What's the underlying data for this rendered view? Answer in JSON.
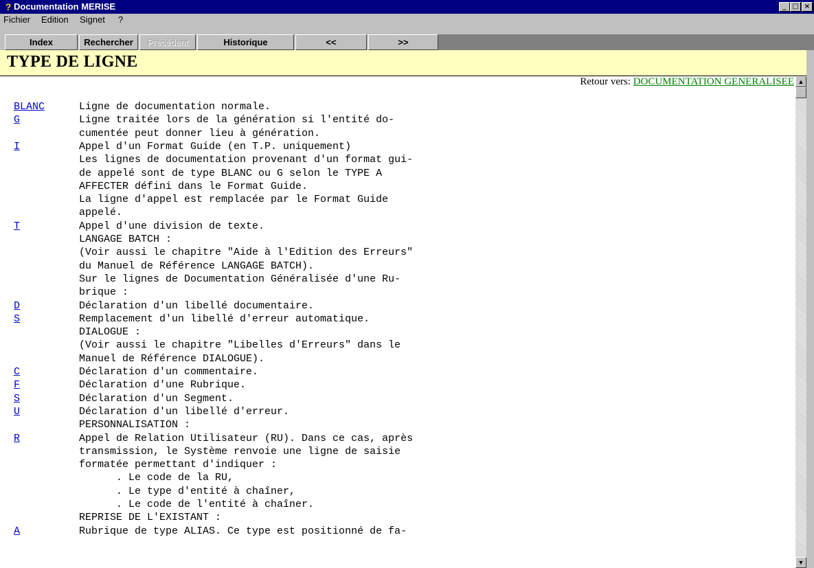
{
  "window": {
    "title": "Documentation MERISE",
    "minimize": "_",
    "maximize": "□",
    "close": "×"
  },
  "menu": [
    {
      "label": "Fichier"
    },
    {
      "label": "Edition"
    },
    {
      "label": "Signet"
    },
    {
      "label": "?"
    }
  ],
  "toolbar": {
    "index": "Index",
    "rechercher": "Rechercher",
    "precedent": "Précédent",
    "historique": "Historique",
    "back": "<<",
    "forward": ">>"
  },
  "page": {
    "title": "TYPE DE LIGNE",
    "retour_label": "Retour vers: ",
    "retour_link": "DOCUMENTATION GENERALISEE"
  },
  "lines": [
    {
      "code": "",
      "text": ""
    },
    {
      "code": "BLANC",
      "text": "Ligne de documentation normale."
    },
    {
      "code": "G",
      "text": "Ligne traitée lors de la génération si l'entité do-"
    },
    {
      "code": "",
      "text": "cumentée peut donner lieu à génération."
    },
    {
      "code": "I",
      "text": "Appel d'un Format Guide (en T.P. uniquement)"
    },
    {
      "code": "",
      "text": "Les lignes de documentation provenant d'un format gui-"
    },
    {
      "code": "",
      "text": "de appelé sont de type BLANC ou G selon le TYPE A"
    },
    {
      "code": "",
      "text": "AFFECTER défini dans le Format Guide."
    },
    {
      "code": "",
      "text": "La ligne d'appel est remplacée par le Format Guide"
    },
    {
      "code": "",
      "text": "appelé."
    },
    {
      "code": "T",
      "text": "Appel d'une division de texte."
    },
    {
      "code": "",
      "text": "LANGAGE BATCH :"
    },
    {
      "code": "",
      "text": "(Voir aussi le chapitre \"Aide à l'Edition des Erreurs\""
    },
    {
      "code": "",
      "text": "du Manuel de Référence LANGAGE BATCH)."
    },
    {
      "code": "",
      "text": "Sur le lignes de Documentation Généralisée d'une Ru-"
    },
    {
      "code": "",
      "text": "brique :"
    },
    {
      "code": "D",
      "text": "Déclaration d'un libellé documentaire."
    },
    {
      "code": "S",
      "text": "Remplacement d'un libellé d'erreur automatique."
    },
    {
      "code": "",
      "text": "DIALOGUE :"
    },
    {
      "code": "",
      "text": "(Voir aussi le chapitre \"Libelles d'Erreurs\" dans le"
    },
    {
      "code": "",
      "text": "Manuel de Référence DIALOGUE)."
    },
    {
      "code": "C",
      "text": "Déclaration d'un commentaire."
    },
    {
      "code": "F",
      "text": "Déclaration d'une Rubrique."
    },
    {
      "code": "S",
      "text": "Déclaration d'un Segment."
    },
    {
      "code": "U",
      "text": "Déclaration d'un libellé d'erreur."
    },
    {
      "code": "",
      "text": "PERSONNALISATION :"
    },
    {
      "code": "R",
      "text": "Appel de Relation Utilisateur (RU). Dans ce cas, après"
    },
    {
      "code": "",
      "text": "transmission, le Système renvoie une ligne de saisie"
    },
    {
      "code": "",
      "text": "formatée permettant d'indiquer :"
    },
    {
      "code": "",
      "text": "      . Le code de la RU,"
    },
    {
      "code": "",
      "text": "      . Le type d'entité à chaîner,"
    },
    {
      "code": "",
      "text": "      . Le code de l'entité à chaîner."
    },
    {
      "code": "",
      "text": "REPRISE DE L'EXISTANT :"
    },
    {
      "code": "A",
      "text": "Rubrique de type ALIAS. Ce type est positionné de fa-"
    }
  ],
  "scrollbar": {
    "up": "▲",
    "down": "▼"
  }
}
